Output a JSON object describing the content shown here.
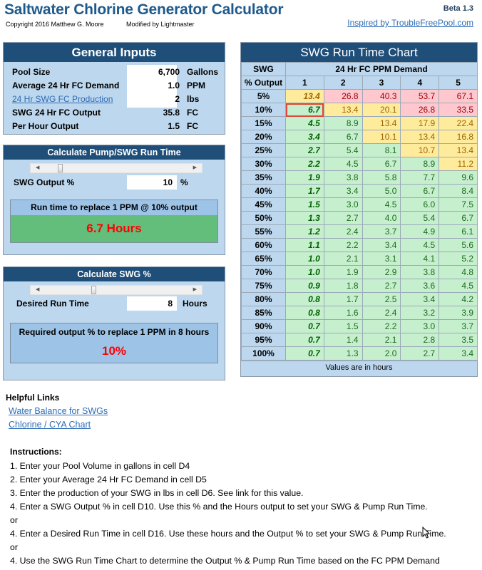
{
  "header": {
    "title": "Saltwater Chlorine Generator Calculator",
    "copyright": "Copyright 2016 Matthew G. Moore",
    "modified": "Modified by Lightmaster",
    "version": "Beta 1.3",
    "inspired_link": "Inspired by TroubleFreePool.com"
  },
  "general_inputs": {
    "title": "General Inputs",
    "rows": [
      {
        "label": "Pool Size",
        "value": "6,700",
        "unit": "Gallons"
      },
      {
        "label": "Average 24 Hr FC Demand",
        "value": "1.0",
        "unit": "PPM"
      },
      {
        "label": "24 Hr SWG FC Production",
        "value": "2",
        "unit": "lbs"
      },
      {
        "label": "SWG 24 Hr FC Output",
        "value": "35.8",
        "unit": "FC"
      },
      {
        "label": "Per Hour Output",
        "value": "1.5",
        "unit": "FC"
      }
    ]
  },
  "pump_calc": {
    "title": "Calculate Pump/SWG Run Time",
    "slider_fraction": 0.1,
    "input_label": "SWG Output %",
    "input_value": "10",
    "input_unit": "%",
    "result_label": "Run time to replace 1 PPM @ 10% output",
    "result_value": "6.7 Hours"
  },
  "swg_calc": {
    "title": "Calculate SWG %",
    "slider_fraction": 0.33,
    "input_label": "Desired Run Time",
    "input_value": "8",
    "input_unit": "Hours",
    "result_label": "Required output % to replace 1 PPM in 8 hours",
    "result_value": "10%"
  },
  "run_time_chart": {
    "title": "SWG Run Time Chart",
    "row_header_line1": "SWG",
    "row_header_line2": "% Output",
    "column_group_header": "24 Hr FC PPM Demand",
    "columns": [
      "1",
      "2",
      "3",
      "4",
      "5"
    ],
    "rows": [
      {
        "label": "5%",
        "values": [
          "13.4",
          "26.8",
          "40.3",
          "53.7",
          "67.1"
        ],
        "colors": [
          "y",
          "r",
          "r",
          "r",
          "r"
        ]
      },
      {
        "label": "10%",
        "values": [
          "6.7",
          "13.4",
          "20.1",
          "26.8",
          "33.5"
        ],
        "colors": [
          "g",
          "y",
          "y",
          "r",
          "r"
        ]
      },
      {
        "label": "15%",
        "values": [
          "4.5",
          "8.9",
          "13.4",
          "17.9",
          "22.4"
        ],
        "colors": [
          "g",
          "g",
          "y",
          "y",
          "y"
        ]
      },
      {
        "label": "20%",
        "values": [
          "3.4",
          "6.7",
          "10.1",
          "13.4",
          "16.8"
        ],
        "colors": [
          "g",
          "g",
          "y",
          "y",
          "y"
        ]
      },
      {
        "label": "25%",
        "values": [
          "2.7",
          "5.4",
          "8.1",
          "10.7",
          "13.4"
        ],
        "colors": [
          "g",
          "g",
          "g",
          "y",
          "y"
        ]
      },
      {
        "label": "30%",
        "values": [
          "2.2",
          "4.5",
          "6.7",
          "8.9",
          "11.2"
        ],
        "colors": [
          "g",
          "g",
          "g",
          "g",
          "y"
        ]
      },
      {
        "label": "35%",
        "values": [
          "1.9",
          "3.8",
          "5.8",
          "7.7",
          "9.6"
        ],
        "colors": [
          "g",
          "g",
          "g",
          "g",
          "g"
        ]
      },
      {
        "label": "40%",
        "values": [
          "1.7",
          "3.4",
          "5.0",
          "6.7",
          "8.4"
        ],
        "colors": [
          "g",
          "g",
          "g",
          "g",
          "g"
        ]
      },
      {
        "label": "45%",
        "values": [
          "1.5",
          "3.0",
          "4.5",
          "6.0",
          "7.5"
        ],
        "colors": [
          "g",
          "g",
          "g",
          "g",
          "g"
        ]
      },
      {
        "label": "50%",
        "values": [
          "1.3",
          "2.7",
          "4.0",
          "5.4",
          "6.7"
        ],
        "colors": [
          "g",
          "g",
          "g",
          "g",
          "g"
        ]
      },
      {
        "label": "55%",
        "values": [
          "1.2",
          "2.4",
          "3.7",
          "4.9",
          "6.1"
        ],
        "colors": [
          "g",
          "g",
          "g",
          "g",
          "g"
        ]
      },
      {
        "label": "60%",
        "values": [
          "1.1",
          "2.2",
          "3.4",
          "4.5",
          "5.6"
        ],
        "colors": [
          "g",
          "g",
          "g",
          "g",
          "g"
        ]
      },
      {
        "label": "65%",
        "values": [
          "1.0",
          "2.1",
          "3.1",
          "4.1",
          "5.2"
        ],
        "colors": [
          "g",
          "g",
          "g",
          "g",
          "g"
        ]
      },
      {
        "label": "70%",
        "values": [
          "1.0",
          "1.9",
          "2.9",
          "3.8",
          "4.8"
        ],
        "colors": [
          "g",
          "g",
          "g",
          "g",
          "g"
        ]
      },
      {
        "label": "75%",
        "values": [
          "0.9",
          "1.8",
          "2.7",
          "3.6",
          "4.5"
        ],
        "colors": [
          "g",
          "g",
          "g",
          "g",
          "g"
        ]
      },
      {
        "label": "80%",
        "values": [
          "0.8",
          "1.7",
          "2.5",
          "3.4",
          "4.2"
        ],
        "colors": [
          "g",
          "g",
          "g",
          "g",
          "g"
        ]
      },
      {
        "label": "85%",
        "values": [
          "0.8",
          "1.6",
          "2.4",
          "3.2",
          "3.9"
        ],
        "colors": [
          "g",
          "g",
          "g",
          "g",
          "g"
        ]
      },
      {
        "label": "90%",
        "values": [
          "0.7",
          "1.5",
          "2.2",
          "3.0",
          "3.7"
        ],
        "colors": [
          "g",
          "g",
          "g",
          "g",
          "g"
        ]
      },
      {
        "label": "95%",
        "values": [
          "0.7",
          "1.4",
          "2.1",
          "2.8",
          "3.5"
        ],
        "colors": [
          "g",
          "g",
          "g",
          "g",
          "g"
        ]
      },
      {
        "label": "100%",
        "values": [
          "0.7",
          "1.3",
          "2.0",
          "2.7",
          "3.4"
        ],
        "colors": [
          "g",
          "g",
          "g",
          "g",
          "g"
        ]
      }
    ],
    "selected_cell": {
      "row": 1,
      "col": 0
    },
    "footer": "Values are in hours"
  },
  "helpful_links": {
    "title": "Helpful Links",
    "links": [
      "Water Balance for SWGs",
      "Chlorine / CYA Chart"
    ]
  },
  "instructions": {
    "title": "Instructions:",
    "lines": [
      "1. Enter your Pool Volume in gallons in cell D4",
      "2. Enter your Average 24 Hr FC Demand in cell D5",
      "3. Enter the production of your SWG in lbs in cell D6.  See link for this value.",
      "4. Enter a SWG Output % in cell D10.  Use this % and the Hours output to set your SWG & Pump Run Time.",
      "or",
      "4. Enter a Desired Run Time in cell D16.  Use these hours and the Output % to set your SWG & Pump Run Time.",
      "or",
      "4. Use the SWG Run Time Chart to determine the Output % & Pump Run Time based on the FC PPM Demand"
    ]
  },
  "colors": {
    "header_blue": "#1F4E79",
    "panel_blue": "#BDD7EE",
    "good_green": "#C6EFCE",
    "warn_yellow": "#FFEB9C",
    "bad_red": "#FFC7CE",
    "result_green": "#63BE7B",
    "result_text_red": "#FF0000"
  }
}
